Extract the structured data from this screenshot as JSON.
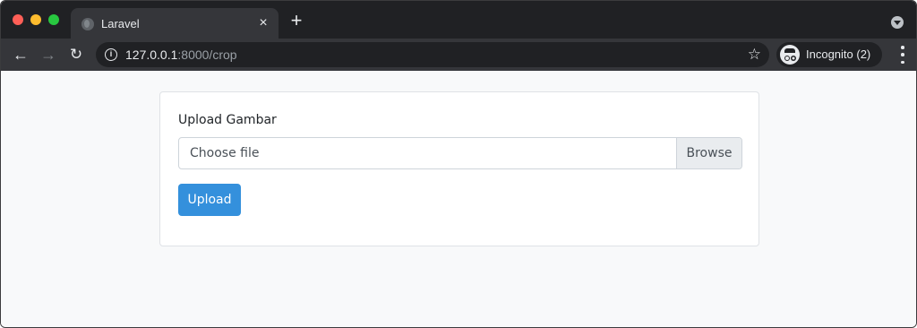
{
  "browser": {
    "tab": {
      "title": "Laravel",
      "close_glyph": "×",
      "favicon": "globe-icon"
    },
    "new_tab_glyph": "+",
    "nav": {
      "back": "←",
      "forward": "→",
      "reload": "↻"
    },
    "address": {
      "host": "127.0.0.1",
      "rest": ":8000/crop",
      "info_glyph": "i",
      "star_glyph": "☆"
    },
    "profile": {
      "label": "Incognito (2)",
      "icon": "incognito-icon"
    },
    "colors": {
      "frame": "#202124",
      "toolbar": "#35363a",
      "text": "#e8eaed"
    }
  },
  "page": {
    "form": {
      "label": "Upload Gambar",
      "file_placeholder": "Choose file",
      "browse_label": "Browse",
      "submit_label": "Upload"
    },
    "colors": {
      "primary": "#3490dc",
      "background": "#f8f9fa"
    }
  }
}
